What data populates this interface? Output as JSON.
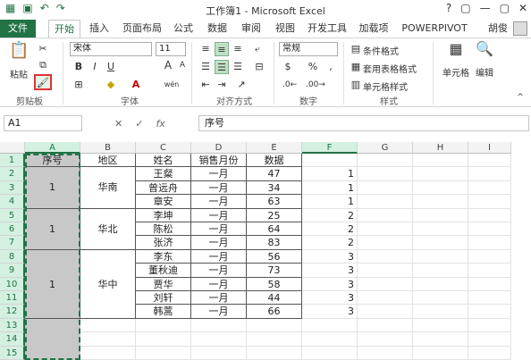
{
  "window": {
    "title": "工作簿1 - Microsoft Excel",
    "controls": [
      "?",
      "▢",
      "—",
      "▢",
      "✕"
    ]
  },
  "qat": [
    "excel-icon",
    "save-icon",
    "undo-icon",
    "redo-icon"
  ],
  "tabs": [
    "文件",
    "开始",
    "插入",
    "页面布局",
    "公式",
    "数据",
    "审阅",
    "视图",
    "开发工具",
    "加载项",
    "POWERPIVOT"
  ],
  "user": "胡俊",
  "ribbon": {
    "clipboard": {
      "label": "剪贴板",
      "paste": "粘贴"
    },
    "font": {
      "label": "字体",
      "name": "宋体",
      "size": "11",
      "bold": "B",
      "italic": "I",
      "underline": "U",
      "grow": "A",
      "shrink": "A",
      "phonetic": "wén"
    },
    "alignment": {
      "label": "对齐方式"
    },
    "number": {
      "label": "数字",
      "format": "常规",
      "currency": "$",
      "percent": "%",
      "comma": ","
    },
    "styles": {
      "label": "样式",
      "conditional": "条件格式",
      "table": "套用表格格式",
      "cell": "单元格样式"
    },
    "cells": {
      "label": "单元格"
    },
    "editing": {
      "label": "编辑"
    }
  },
  "formula_bar": {
    "name_box": "A1",
    "cancel": "✕",
    "enter": "✓",
    "fx": "fx",
    "content": "序号"
  },
  "grid": {
    "columns": [
      "A",
      "B",
      "C",
      "D",
      "E",
      "F",
      "G",
      "H",
      "I"
    ],
    "rows": [
      "1",
      "2",
      "3",
      "4",
      "5",
      "6",
      "7",
      "8",
      "9",
      "10",
      "11",
      "12",
      "13",
      "14",
      "15"
    ],
    "headers": [
      "序号",
      "地区",
      "姓名",
      "销售月份",
      "数据"
    ],
    "groups": [
      {
        "seq": "1",
        "region": "华南"
      },
      {
        "seq": "1",
        "region": "华北"
      },
      {
        "seq": "1",
        "region": "华中"
      }
    ],
    "records": [
      {
        "name": "王粲",
        "month": "一月",
        "value": "47",
        "f": "1"
      },
      {
        "name": "曾远舟",
        "month": "一月",
        "value": "34",
        "f": "1"
      },
      {
        "name": "章安",
        "month": "一月",
        "value": "63",
        "f": "1"
      },
      {
        "name": "李坤",
        "month": "一月",
        "value": "25",
        "f": "2"
      },
      {
        "name": "陈松",
        "month": "一月",
        "value": "64",
        "f": "2"
      },
      {
        "name": "张济",
        "month": "一月",
        "value": "83",
        "f": "2"
      },
      {
        "name": "李东",
        "month": "一月",
        "value": "56",
        "f": "3"
      },
      {
        "name": "董秋迪",
        "month": "一月",
        "value": "73",
        "f": "3"
      },
      {
        "name": "贾华",
        "month": "一月",
        "value": "58",
        "f": "3"
      },
      {
        "name": "刘轩",
        "month": "一月",
        "value": "44",
        "f": "3"
      },
      {
        "name": "韩蒿",
        "month": "一月",
        "value": "66",
        "f": "3"
      }
    ]
  }
}
